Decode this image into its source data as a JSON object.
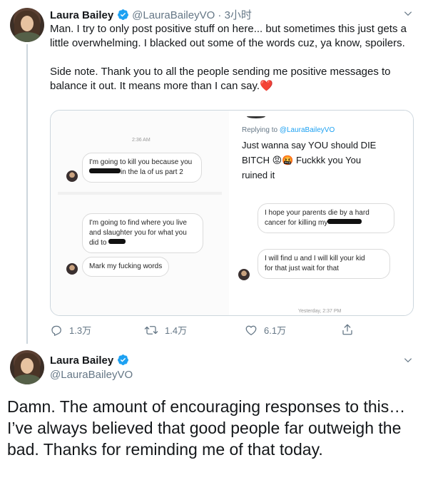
{
  "tweet1": {
    "author_name": "Laura Bailey",
    "handle": "@LauraBaileyVO",
    "time_sep": " · ",
    "time": "3小时",
    "paragraph1": "Man. I try to only post positive stuff on here... but sometimes this just gets a little overwhelming. I blacked out some of the words cuz, ya know, spoilers.",
    "paragraph2": "Side note. Thank you to all the people sending me positive messages to balance it out. It means more than I can say.",
    "heart_emoji": "❤️",
    "media": {
      "left_time": "2:36 AM",
      "msg1_a": "I'm going to kill you because you",
      "msg1_b": "in the la of us part 2",
      "msg2_a": "I'm going to find where you live",
      "msg2_b": "and slaughter you for what you",
      "msg2_c": "did to",
      "msg3": "Mark my fucking words",
      "reply_prefix": "Replying to ",
      "reply_handle": "@LauraBaileyVO",
      "reply_text_a": "Just wanna say YOU should DIE",
      "reply_text_b": "BITCH",
      "reply_emojis": "😡🤬",
      "reply_text_c": "Fuckkk you You",
      "reply_text_d": "ruined it",
      "msg4_a": "I hope your parents die by a hard",
      "msg4_b": "cancer for killing my",
      "msg5_a": "I will find u and I will kill your kid",
      "msg5_b": "for that just wait for that",
      "right_time": "Yesterday, 2:37 PM"
    },
    "actions": {
      "reply_count": "1.3万",
      "retweet_count": "1.4万",
      "like_count": "6.1万"
    }
  },
  "tweet2": {
    "author_name": "Laura Bailey",
    "handle": "@LauraBaileyVO",
    "text": "Damn. The amount of encouraging responses to this… I’ve always believed that good people far outweigh the bad. Thanks for reminding me of that today."
  },
  "colors": {
    "verified": "#1da1f2",
    "secondary_text": "#657786",
    "link": "#1da1f2",
    "heart": "#e0245e"
  },
  "icons": [
    "verified-badge-icon",
    "chevron-down-icon",
    "reply-icon",
    "retweet-icon",
    "like-icon",
    "share-icon"
  ]
}
